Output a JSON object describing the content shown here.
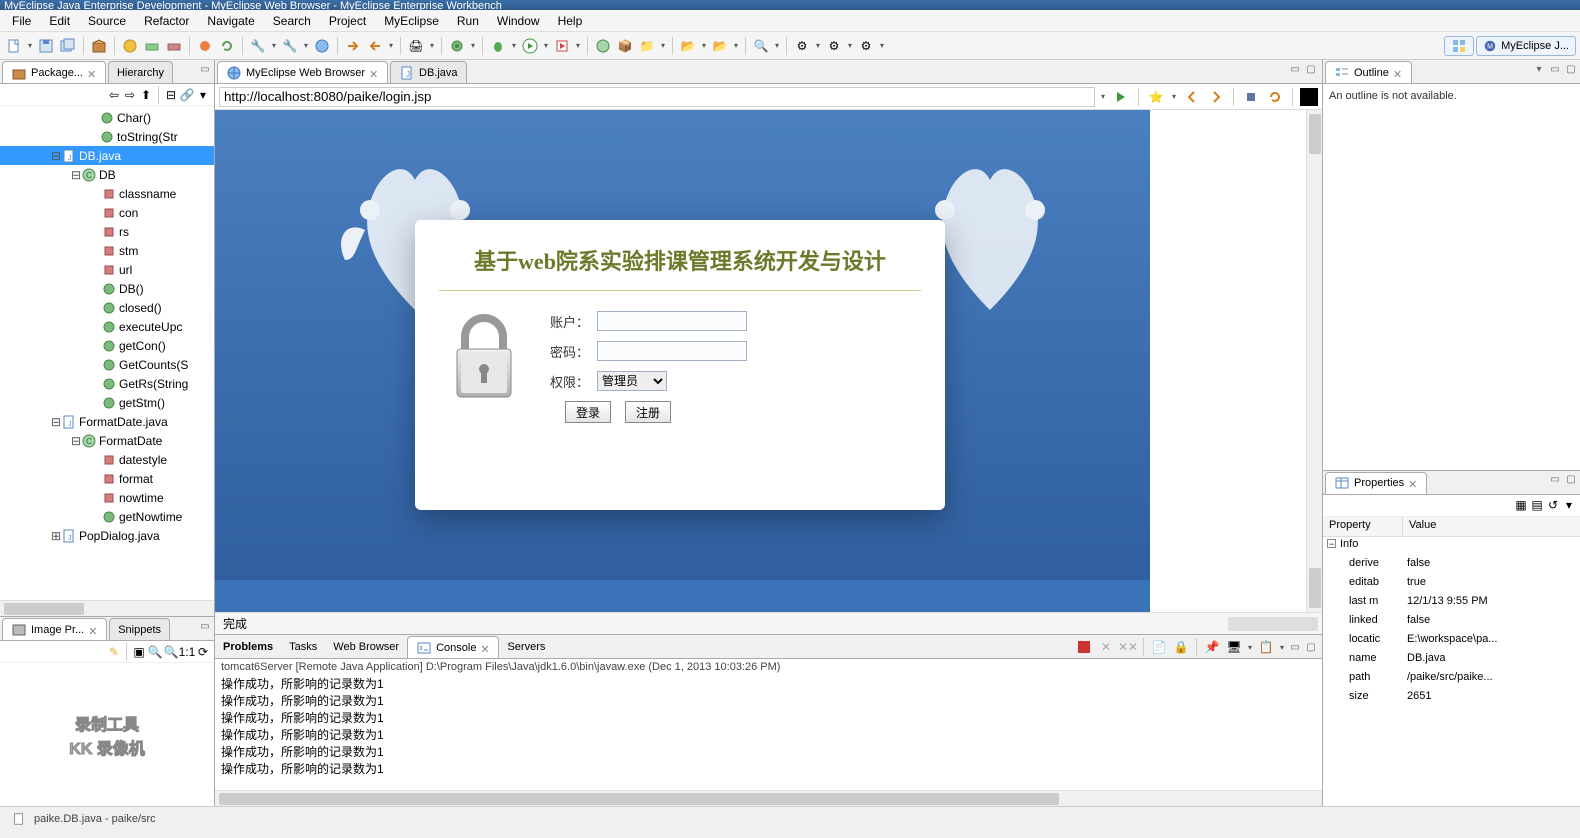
{
  "window_title": "MyEclipse Java Enterprise Development - MyEclipse Web Browser - MyEclipse Enterprise Workbench",
  "menubar": [
    "File",
    "Edit",
    "Source",
    "Refactor",
    "Navigate",
    "Search",
    "Project",
    "MyEclipse",
    "Run",
    "Window",
    "Help"
  ],
  "perspective_label": "MyEclipse J...",
  "left_tabs": {
    "active": "Package...",
    "other": "Hierarchy"
  },
  "tree": [
    {
      "indent": 88,
      "icon": "method-green",
      "label": "Char()"
    },
    {
      "indent": 88,
      "icon": "method-green",
      "label": "toString(Str"
    },
    {
      "indent": 50,
      "toggle": "-",
      "icon": "java-file",
      "label": "DB.java",
      "selected": true
    },
    {
      "indent": 70,
      "toggle": "-",
      "icon": "class-green",
      "label": "DB"
    },
    {
      "indent": 90,
      "icon": "field-red",
      "label": "classname"
    },
    {
      "indent": 90,
      "icon": "field-red",
      "label": "con"
    },
    {
      "indent": 90,
      "icon": "field-red",
      "label": "rs"
    },
    {
      "indent": 90,
      "icon": "field-red",
      "label": "stm"
    },
    {
      "indent": 90,
      "icon": "field-red",
      "label": "url"
    },
    {
      "indent": 90,
      "icon": "method-green",
      "label": "DB()"
    },
    {
      "indent": 90,
      "icon": "method-green",
      "label": "closed()"
    },
    {
      "indent": 90,
      "icon": "method-green",
      "label": "executeUpc"
    },
    {
      "indent": 90,
      "icon": "method-green",
      "label": "getCon()"
    },
    {
      "indent": 90,
      "icon": "method-green",
      "label": "GetCounts(S"
    },
    {
      "indent": 90,
      "icon": "method-green",
      "label": "GetRs(String"
    },
    {
      "indent": 90,
      "icon": "method-green",
      "label": "getStm()"
    },
    {
      "indent": 50,
      "toggle": "-",
      "icon": "java-file",
      "label": "FormatDate.java"
    },
    {
      "indent": 70,
      "toggle": "-",
      "icon": "class-green",
      "label": "FormatDate"
    },
    {
      "indent": 90,
      "icon": "field-red",
      "label": "datestyle"
    },
    {
      "indent": 90,
      "icon": "field-red",
      "label": "format"
    },
    {
      "indent": 90,
      "icon": "field-red",
      "label": "nowtime"
    },
    {
      "indent": 90,
      "icon": "method-green",
      "label": "getNowtime"
    },
    {
      "indent": 50,
      "toggle": "+",
      "icon": "java-file",
      "label": "PopDialog.java"
    }
  ],
  "lower_left_tabs": {
    "active": "Image Pr...",
    "other": "Snippets"
  },
  "watermark": {
    "line1": "录制工具",
    "line2": "KK 录像机"
  },
  "editor_tabs": [
    {
      "icon": "globe",
      "label": "MyEclipse Web Browser",
      "active": true,
      "closable": true
    },
    {
      "icon": "java-file",
      "label": "DB.java",
      "active": false
    }
  ],
  "url": "http://localhost:8080/paike/login.jsp",
  "login_page": {
    "title": "基于web院系实验排课管理系统开发与设计",
    "labels": {
      "user": "账户：",
      "pass": "密码：",
      "role": "权限："
    },
    "role_option": "管理员",
    "btn_login": "登录",
    "btn_register": "注册"
  },
  "browser_status": "完成",
  "bottom_tabs": [
    "Problems",
    "Tasks",
    "Web Browser",
    "Console",
    "Servers"
  ],
  "bottom_active": 3,
  "console_header": "tomcat6Server [Remote Java Application] D:\\Program Files\\Java\\jdk1.6.0\\bin\\javaw.exe (Dec 1, 2013 10:03:26 PM)",
  "console_lines": [
    "操作成功，所影响的记录数为1",
    "操作成功，所影响的记录数为1",
    "操作成功，所影响的记录数为1",
    "操作成功，所影响的记录数为1",
    "操作成功，所影响的记录数为1",
    "操作成功，所影响的记录数为1"
  ],
  "outline_tab": "Outline",
  "outline_msg": "An outline is not available.",
  "properties_tab": "Properties",
  "properties_cols": {
    "key": "Property",
    "val": "Value"
  },
  "properties_group": "Info",
  "properties": [
    {
      "k": "derive",
      "v": "false"
    },
    {
      "k": "editab",
      "v": "true"
    },
    {
      "k": "last m",
      "v": "12/1/13 9:55 PM"
    },
    {
      "k": "linked",
      "v": "false"
    },
    {
      "k": "locatic",
      "v": "E:\\workspace\\pa..."
    },
    {
      "k": "name",
      "v": "DB.java"
    },
    {
      "k": "path",
      "v": "/paike/src/paike..."
    },
    {
      "k": "size",
      "v": "2651"
    }
  ],
  "status_path": "paike.DB.java - paike/src"
}
